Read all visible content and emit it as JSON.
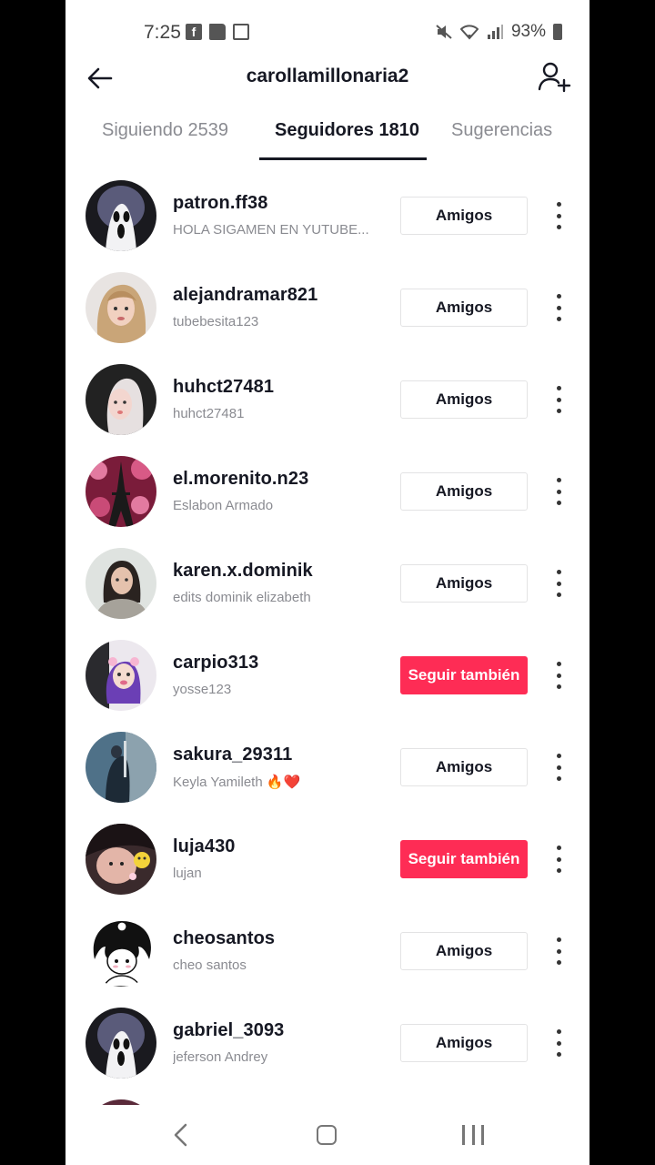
{
  "status": {
    "time": "7:25",
    "battery": "93%"
  },
  "header": {
    "title": "carollamillonaria2"
  },
  "tabs": [
    {
      "label": "Siguiendo 2539"
    },
    {
      "label": "Seguidores 1810"
    },
    {
      "label": "Sugerencias"
    }
  ],
  "followers": [
    {
      "username": "patron.ff38",
      "nickname": "HOLA SIGAMEN EN YUTUBE...",
      "button": "Amigos",
      "button_style": "outline"
    },
    {
      "username": "alejandramar821",
      "nickname": "tubebesita123",
      "button": "Amigos",
      "button_style": "outline"
    },
    {
      "username": "huhct27481",
      "nickname": "huhct27481",
      "button": "Amigos",
      "button_style": "outline"
    },
    {
      "username": "el.morenito.n23",
      "nickname": "Eslabon Armado",
      "button": "Amigos",
      "button_style": "outline"
    },
    {
      "username": "karen.x.dominik",
      "nickname": "edits  dominik  elizabeth",
      "button": "Amigos",
      "button_style": "outline"
    },
    {
      "username": "carpio313",
      "nickname": "yosse123",
      "button": "Seguir también",
      "button_style": "primary"
    },
    {
      "username": "sakura_29311",
      "nickname": "Keyla Yamileth 🔥❤️",
      "button": "Amigos",
      "button_style": "outline"
    },
    {
      "username": "luja430",
      "nickname": "lujan",
      "button": "Seguir también",
      "button_style": "primary"
    },
    {
      "username": "cheosantos",
      "nickname": "cheo santos",
      "button": "Amigos",
      "button_style": "outline"
    },
    {
      "username": "gabriel_3093",
      "nickname": "jeferson Andrey",
      "button": "Amigos",
      "button_style": "outline"
    }
  ],
  "colors": {
    "accent": "#fe2c55",
    "text": "#161823",
    "muted": "#8a8b91"
  },
  "icons": {
    "back": "arrow-left-icon",
    "add_user": "add-user-icon",
    "more": "more-vertical-icon"
  }
}
